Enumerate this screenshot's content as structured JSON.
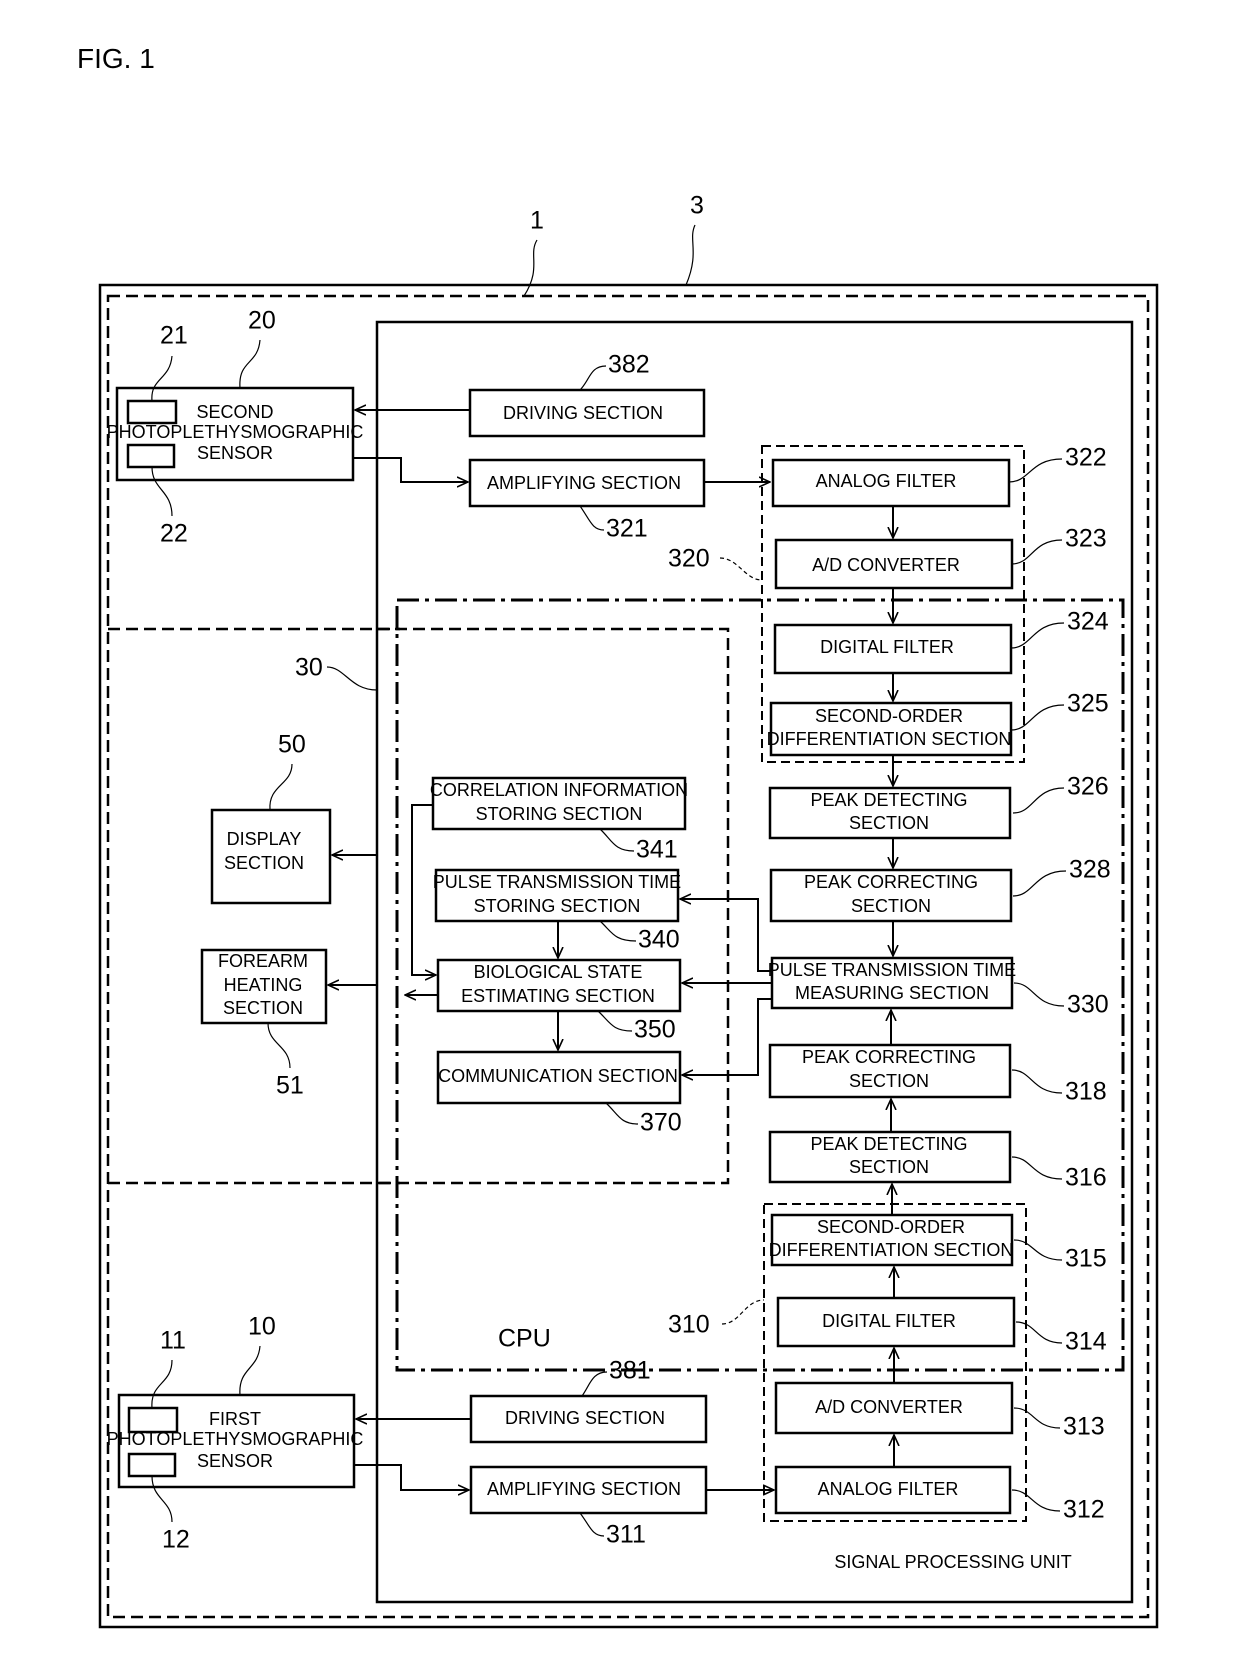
{
  "figure_title": "FIG. 1",
  "refs": {
    "system": "1",
    "device": "3",
    "second_sensor": "20",
    "second_sensor_part_a": "21",
    "second_sensor_part_b": "22",
    "first_sensor": "10",
    "first_sensor_part_a": "11",
    "first_sensor_part_b": "12",
    "signal_processing_unit": "30",
    "display": "50",
    "forearm_heating": "51",
    "driving_2": "382",
    "amplifying_2": "321",
    "filter_group_2": "320",
    "analog_filter_2": "322",
    "ad_converter_2": "323",
    "digital_filter_2": "324",
    "second_order_2": "325",
    "peak_detect_2": "326",
    "peak_correct_2": "328",
    "ptt_measure": "330",
    "peak_correct_1": "318",
    "peak_detect_1": "316",
    "second_order_1": "315",
    "digital_filter_1": "314",
    "filter_group_1": "310",
    "ad_converter_1": "313",
    "analog_filter_1": "312",
    "driving_1": "381",
    "amplifying_1": "311",
    "correlation_store": "341",
    "ptt_store": "340",
    "bio_state": "350",
    "communication": "370"
  },
  "labels": {
    "second_sensor": [
      "SECOND",
      "PHOTOPLETHYSMOGRAPHIC",
      "SENSOR"
    ],
    "first_sensor": [
      "FIRST",
      "PHOTOPLETHYSMOGRAPHIC",
      "SENSOR"
    ],
    "display": [
      "DISPLAY",
      "SECTION"
    ],
    "forearm_heating": [
      "FOREARM",
      "HEATING",
      "SECTION"
    ],
    "driving": "DRIVING SECTION",
    "amplifying": "AMPLIFYING SECTION",
    "analog_filter": "ANALOG FILTER",
    "ad_converter": "A/D CONVERTER",
    "digital_filter": "DIGITAL FILTER",
    "second_order": [
      "SECOND-ORDER",
      "DIFFERENTIATION SECTION"
    ],
    "peak_detect": [
      "PEAK DETECTING",
      "SECTION"
    ],
    "peak_correct": [
      "PEAK CORRECTING",
      "SECTION"
    ],
    "ptt_measure": [
      "PULSE TRANSMISSION TIME",
      "MEASURING SECTION"
    ],
    "correlation_store": [
      "CORRELATION INFORMATION",
      "STORING SECTION"
    ],
    "ptt_store": [
      "PULSE TRANSMISSION TIME",
      "STORING SECTION"
    ],
    "bio_state": [
      "BIOLOGICAL STATE",
      "ESTIMATING SECTION"
    ],
    "communication": "COMMUNICATION SECTION",
    "cpu": "CPU",
    "signal_processing_unit": "SIGNAL PROCESSING UNIT"
  }
}
